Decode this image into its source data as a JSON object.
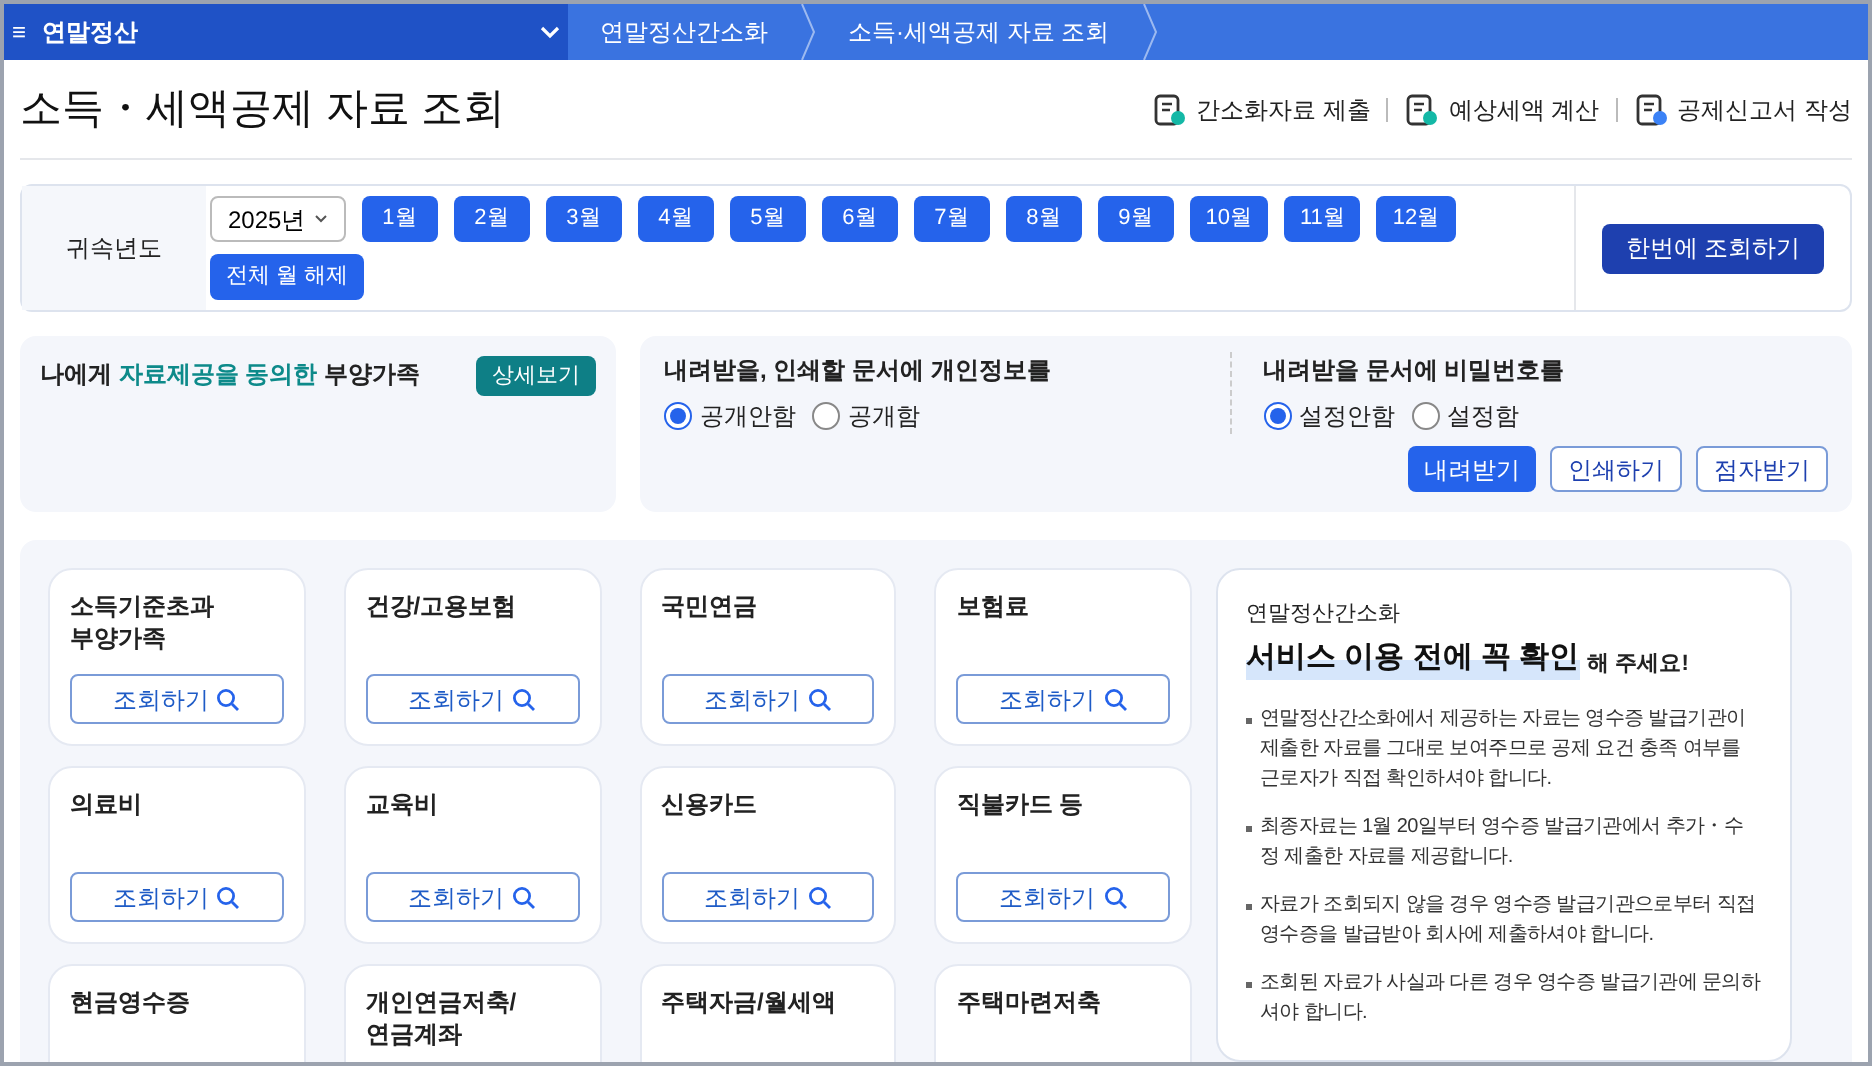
{
  "nav": {
    "menu_icon": "≡",
    "title": "연말정산",
    "breadcrumbs": [
      "연말정산간소화",
      "소득·세액공제 자료 조회"
    ]
  },
  "page": {
    "title": "소득・세액공제 자료 조회",
    "actions": [
      "간소화자료 제출",
      "예상세액 계산",
      "공제신고서 작성"
    ]
  },
  "period": {
    "label": "귀속년도",
    "year": "2025년",
    "months": [
      {
        "label": "1월",
        "selected": true
      },
      {
        "label": "2월",
        "selected": true
      },
      {
        "label": "3월",
        "selected": true
      },
      {
        "label": "4월",
        "selected": true
      },
      {
        "label": "5월",
        "selected": true
      },
      {
        "label": "6월",
        "selected": true
      },
      {
        "label": "7월",
        "selected": true
      },
      {
        "label": "8월",
        "selected": true
      },
      {
        "label": "9월",
        "selected": true
      },
      {
        "label": "10월",
        "selected": true
      },
      {
        "label": "11월",
        "selected": true
      },
      {
        "label": "12월",
        "selected": true
      }
    ],
    "clear_button": "전체 월 해제",
    "search_all_button": "한번에 조회하기"
  },
  "dependents": {
    "title": [
      {
        "text": "나에게 ",
        "highlight": false
      },
      {
        "text": "자료제공을 동의한",
        "highlight": true
      },
      {
        "text": " 부양가족",
        "highlight": false
      }
    ],
    "detail_button": "상세보기"
  },
  "download": {
    "privacy": {
      "label": "내려받을, 인쇄할 문서에 개인정보를",
      "options": [
        {
          "label": "공개안함",
          "selected": true
        },
        {
          "label": "공개함",
          "selected": false
        }
      ]
    },
    "password": {
      "label": "내려받을 문서에 비밀번호를",
      "options": [
        {
          "label": "설정안함",
          "selected": true
        },
        {
          "label": "설정함",
          "selected": false
        }
      ]
    },
    "buttons": [
      {
        "label": "내려받기",
        "kind": "primary"
      },
      {
        "label": "인쇄하기",
        "kind": "outline"
      },
      {
        "label": "점자받기",
        "kind": "outline"
      }
    ]
  },
  "categories": [
    {
      "name": "소득기준초과\n부양가족",
      "button": "조회하기"
    },
    {
      "name": "건강/고용보험",
      "button": "조회하기"
    },
    {
      "name": "국민연금",
      "button": "조회하기"
    },
    {
      "name": "보험료",
      "button": "조회하기"
    },
    {
      "name": "의료비",
      "button": "조회하기"
    },
    {
      "name": "교육비",
      "button": "조회하기"
    },
    {
      "name": "신용카드",
      "button": "조회하기"
    },
    {
      "name": "직불카드 등",
      "button": "조회하기"
    },
    {
      "name": "현금영수증"
    },
    {
      "name": "개인연금저축/\n연금계좌"
    },
    {
      "name": "주택자금/월세액"
    },
    {
      "name": "주택마련저축"
    }
  ],
  "notice": {
    "subtitle": "연말정산간소화",
    "heading": "서비스 이용 전에 꼭 확인",
    "heading_suffix": "해 주세요!",
    "items": [
      "연말정산간소화에서 제공하는 자료는 영수증 발급기관이 제출한 자료를 그대로 보여주므로 공제 요건 충족 여부를 근로자가 직접 확인하셔야 합니다.",
      "최종자료는 1월 20일부터 영수증 발급기관에서 추가・수정 제출한 자료를 제공합니다.",
      "자료가 조회되지 않을 경우 영수증 발급기관으로부터 직접 영수증을 발급받아 회사에 제출하셔야 합니다.",
      "조회된 자료가 사실과 다른 경우 영수증 발급기관에 문의하셔야 합니다."
    ]
  }
}
